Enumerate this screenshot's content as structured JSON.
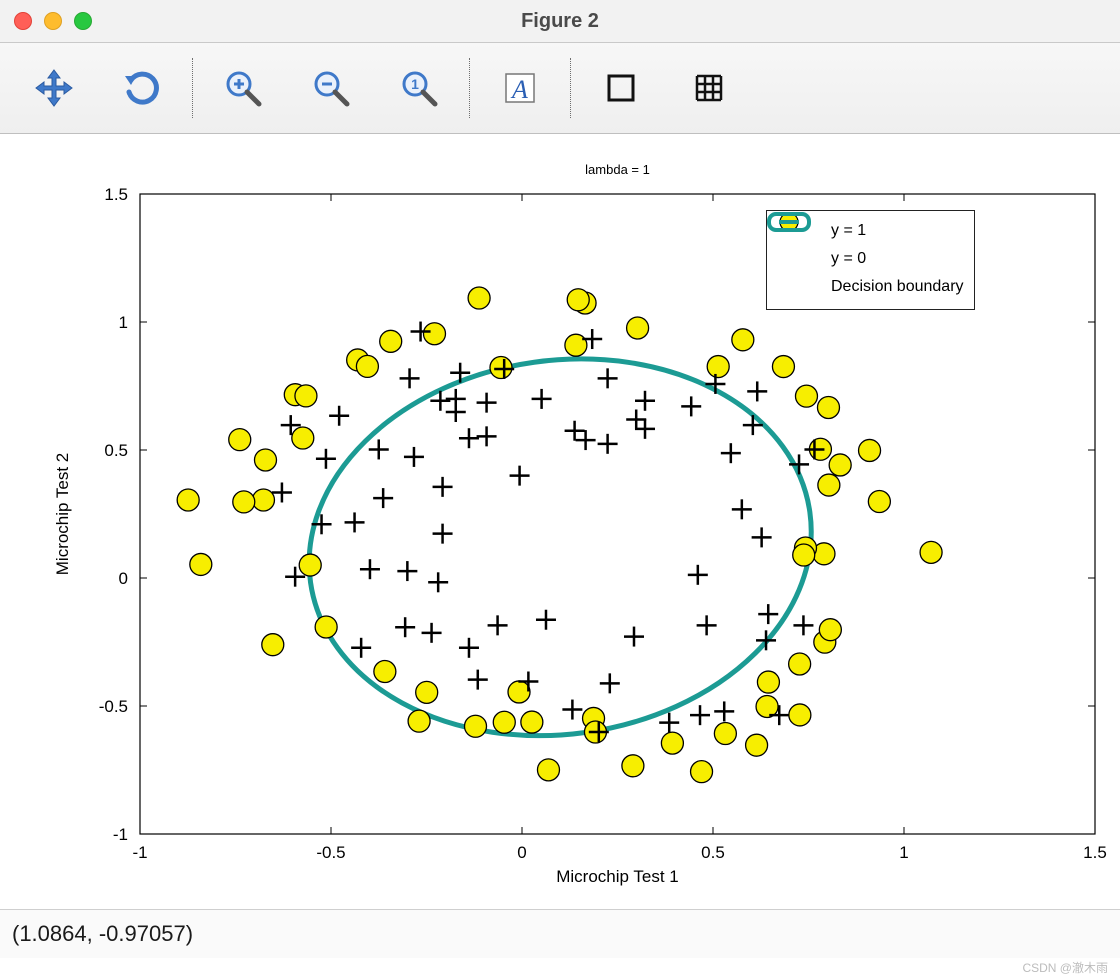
{
  "window": {
    "title": "Figure 2"
  },
  "toolbar": {
    "icons": [
      "pan",
      "rotate",
      "zoom-in",
      "zoom-out",
      "zoom-reset",
      "text-annotation",
      "rectangle",
      "grid"
    ]
  },
  "status": {
    "cursor": "(1.0864, -0.97057)"
  },
  "watermark": "CSDN @澈木雨",
  "chart_data": {
    "type": "scatter",
    "title": "lambda = 1",
    "xlabel": "Microchip Test 1",
    "ylabel": "Microchip Test 2",
    "xlim": [
      -1,
      1.5
    ],
    "ylim": [
      -1,
      1.5
    ],
    "xticks": [
      -1,
      -0.5,
      0,
      0.5,
      1,
      1.5
    ],
    "yticks": [
      -1,
      -0.5,
      0,
      0.5,
      1,
      1.5
    ],
    "legend": {
      "position": "northeast",
      "entries": [
        "y = 1",
        "y = 0",
        "Decision boundary"
      ]
    },
    "series": [
      {
        "name": "y = 1",
        "marker": "plus",
        "color": "#000000",
        "points": [
          [
            0.051267,
            0.69956
          ],
          [
            -0.092742,
            0.68494
          ],
          [
            -0.21371,
            0.69225
          ],
          [
            -0.375,
            0.50219
          ],
          [
            -0.51325,
            0.46564
          ],
          [
            -0.52477,
            0.2098
          ],
          [
            -0.39804,
            0.034357
          ],
          [
            -0.30588,
            -0.19225
          ],
          [
            0.016705,
            -0.40424
          ],
          [
            0.13191,
            -0.51389
          ],
          [
            0.38537,
            -0.56506
          ],
          [
            0.52938,
            -0.5212
          ],
          [
            0.63882,
            -0.24342
          ],
          [
            0.73675,
            -0.18494
          ],
          [
            0.54666,
            0.48757
          ],
          [
            0.322,
            0.5826
          ],
          [
            0.16647,
            0.53874
          ],
          [
            -0.046659,
            0.81652
          ],
          [
            -0.17339,
            0.69956
          ],
          [
            -0.47869,
            0.63377
          ],
          [
            -0.60541,
            0.59722
          ],
          [
            -0.62846,
            0.33406
          ],
          [
            -0.59389,
            0.005117
          ],
          [
            -0.42108,
            -0.27266
          ],
          [
            -0.11578,
            -0.39693
          ],
          [
            0.20104,
            -0.60161
          ],
          [
            0.46601,
            -0.53582
          ],
          [
            0.67339,
            -0.53582
          ],
          [
            -0.13882,
            0.54605
          ],
          [
            -0.29435,
            0.77997
          ],
          [
            -0.26555,
            0.96272
          ],
          [
            -0.16187,
            0.8019
          ],
          [
            -0.17339,
            0.64839
          ],
          [
            -0.28283,
            0.47295
          ],
          [
            -0.36348,
            0.31213
          ],
          [
            -0.30012,
            0.027047
          ],
          [
            -0.23675,
            -0.21418
          ],
          [
            -0.06394,
            -0.18494
          ],
          [
            0.062788,
            -0.16301
          ],
          [
            0.22984,
            -0.41155
          ],
          [
            0.2932,
            -0.2288
          ],
          [
            0.48329,
            -0.18494
          ],
          [
            0.64459,
            -0.14108
          ],
          [
            0.46025,
            0.012427
          ],
          [
            0.6273,
            0.15863
          ],
          [
            0.57546,
            0.26827
          ],
          [
            0.72523,
            0.44371
          ],
          [
            0.22408,
            0.52412
          ],
          [
            0.44297,
            0.67032
          ],
          [
            0.322,
            0.69225
          ],
          [
            0.13767,
            0.57529
          ],
          [
            -0.0063364,
            0.39985
          ],
          [
            -0.092742,
            0.55336
          ],
          [
            -0.20795,
            0.35599
          ],
          [
            -0.20795,
            0.17325
          ],
          [
            -0.43836,
            0.21711
          ],
          [
            -0.21947,
            -0.016813
          ],
          [
            -0.13882,
            -0.27266
          ],
          [
            0.18376,
            0.93348
          ],
          [
            0.22408,
            0.77997
          ],
          [
            0.29896,
            0.61915
          ],
          [
            0.50634,
            0.75804
          ],
          [
            0.61578,
            0.7288
          ],
          [
            0.60426,
            0.59722
          ],
          [
            0.76555,
            0.50219
          ]
        ]
      },
      {
        "name": "y = 0",
        "marker": "circle",
        "color": "#f7ee00",
        "points": [
          [
            -0.6715,
            0.46097
          ],
          [
            -0.5935,
            0.71612
          ],
          [
            -0.4302,
            0.85179
          ],
          [
            -0.3437,
            0.92447
          ],
          [
            -0.2291,
            0.95419
          ],
          [
            -0.1123,
            1.0937
          ],
          [
            0.1651,
            1.0743
          ],
          [
            -0.055,
            0.82214
          ],
          [
            -0.4047,
            0.82661
          ],
          [
            -0.5656,
            0.71138
          ],
          [
            -0.5738,
            0.54676
          ],
          [
            -0.7389,
            0.54055
          ],
          [
            -0.6768,
            0.30474
          ],
          [
            -0.7283,
            0.29729
          ],
          [
            -0.8739,
            0.30474
          ],
          [
            -0.8408,
            0.05306
          ],
          [
            -0.6524,
            -0.26044
          ],
          [
            -0.5127,
            -0.19131
          ],
          [
            -0.5544,
            0.05051
          ],
          [
            -0.359,
            -0.36527
          ],
          [
            -0.2495,
            -0.44666
          ],
          [
            -0.2694,
            -0.55914
          ],
          [
            -0.1217,
            -0.5791
          ],
          [
            -0.0464,
            -0.56355
          ],
          [
            -0.0078,
            -0.44512
          ],
          [
            0.0258,
            -0.56281
          ],
          [
            0.0693,
            -0.74938
          ],
          [
            0.1873,
            -0.54851
          ],
          [
            0.2903,
            -0.73358
          ],
          [
            0.1923,
            -0.6016
          ],
          [
            0.47,
            -0.75638
          ],
          [
            0.3937,
            -0.6449
          ],
          [
            0.5324,
            -0.60756
          ],
          [
            0.6141,
            -0.65298
          ],
          [
            0.6415,
            -0.50187
          ],
          [
            0.6451,
            -0.40659
          ],
          [
            0.7274,
            -0.53494
          ],
          [
            0.7268,
            -0.3358
          ],
          [
            0.7927,
            -0.25061
          ],
          [
            0.8072,
            -0.20186
          ],
          [
            0.7905,
            0.09451
          ],
          [
            0.7421,
            0.11721
          ],
          [
            0.7375,
            0.08978
          ],
          [
            0.8033,
            0.36301
          ],
          [
            0.8329,
            0.44158
          ],
          [
            0.9098,
            0.49821
          ],
          [
            0.9355,
            0.29874
          ],
          [
            1.0709,
            0.10015
          ],
          [
            0.8023,
            0.66608
          ],
          [
            0.7812,
            0.50287
          ],
          [
            0.6844,
            0.82598
          ],
          [
            0.7447,
            0.71038
          ],
          [
            0.5781,
            0.93048
          ],
          [
            0.5136,
            0.82599
          ],
          [
            0.3026,
            0.97659
          ],
          [
            0.1411,
            0.90937
          ],
          [
            0.1472,
            1.0869
          ]
        ]
      }
    ],
    "decision_boundary": {
      "color": "#1c9b94",
      "ellipse": {
        "cx": 0.1,
        "cy": 0.12,
        "rx": 0.66,
        "ry": 0.73,
        "angle_deg": -8
      }
    }
  }
}
